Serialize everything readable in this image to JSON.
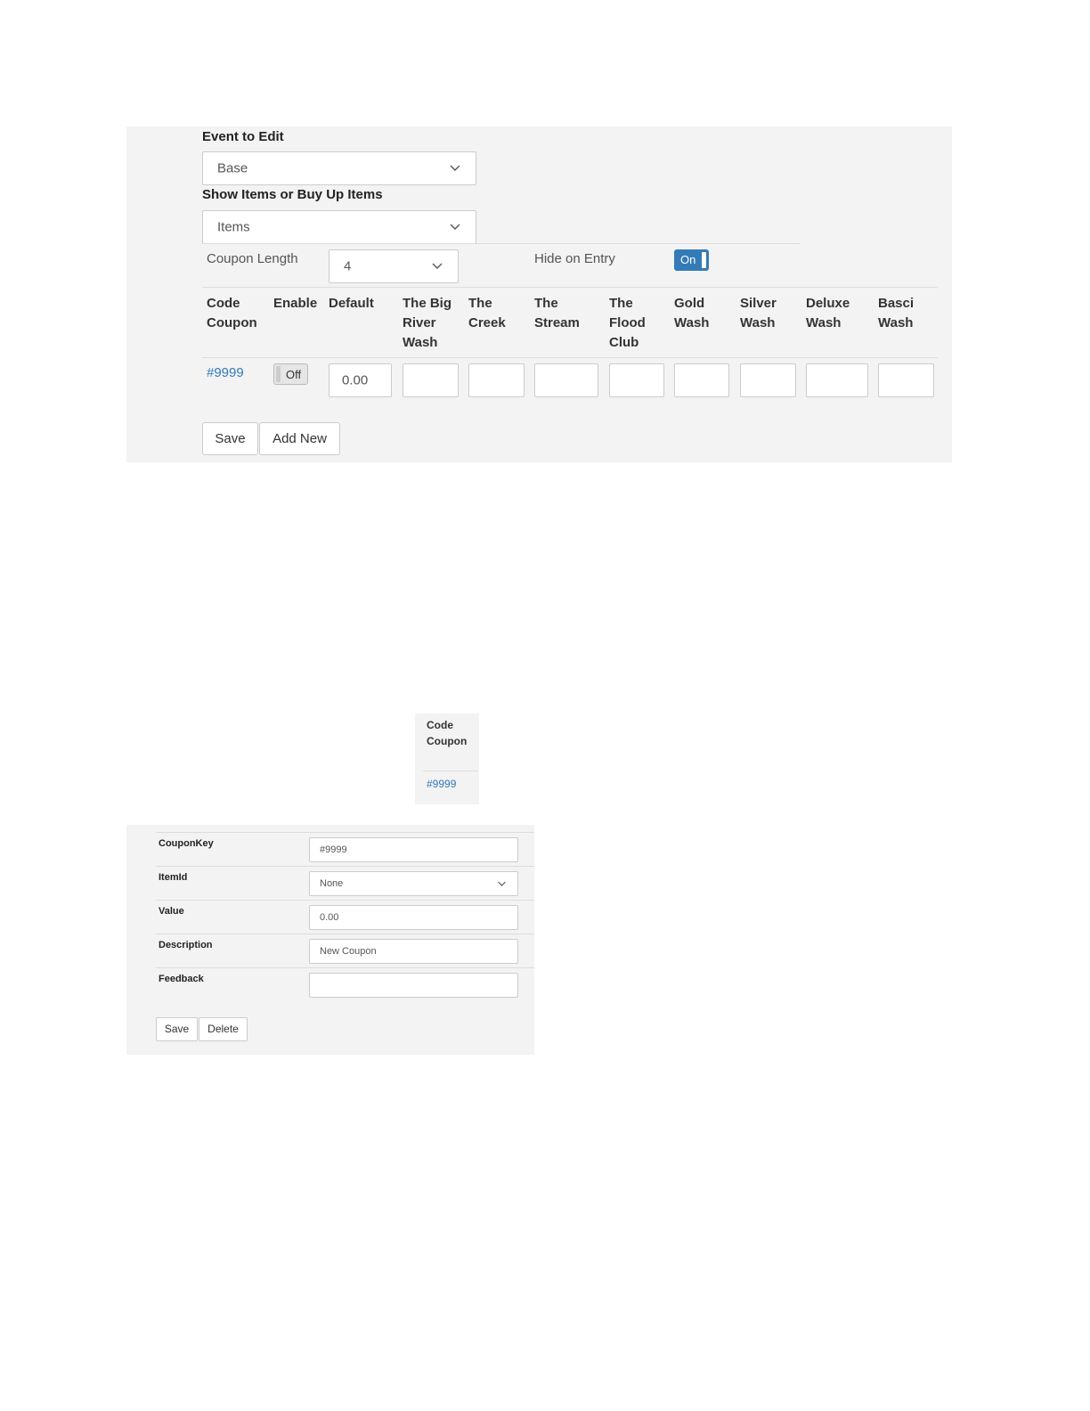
{
  "top_panel": {
    "event_label": "Event to Edit",
    "event_value": "Base",
    "show_items_label": "Show Items or Buy Up Items",
    "show_items_value": "Items",
    "coupon_length_label": "Coupon Length",
    "coupon_length_value": "4",
    "hide_on_entry_label": "Hide on Entry",
    "hide_on_entry_toggle": "On",
    "columns": [
      [
        "Code",
        "Coupon"
      ],
      [
        "Enable"
      ],
      [
        "Default"
      ],
      [
        "The Big",
        "River",
        "Wash"
      ],
      [
        "The",
        "Creek"
      ],
      [
        "The",
        "Stream"
      ],
      [
        "The",
        "Flood",
        "Club"
      ],
      [
        "Gold",
        "Wash"
      ],
      [
        "Silver",
        "Wash"
      ],
      [
        "Deluxe",
        "Wash"
      ],
      [
        "Basci",
        "Wash"
      ]
    ],
    "row": {
      "code": "#9999",
      "enable_toggle": "Off",
      "default_value": "0.00"
    },
    "save_button": "Save",
    "add_new_button": "Add New"
  },
  "mini_panel": {
    "header_line1": "Code",
    "header_line2": "Coupon",
    "code": "#9999"
  },
  "detail_panel": {
    "fields": [
      {
        "label": "CouponKey",
        "value": "#9999"
      },
      {
        "label": "ItemId",
        "value": "None"
      },
      {
        "label": "Value",
        "value": "0.00"
      },
      {
        "label": "Description",
        "value": "New Coupon"
      },
      {
        "label": "Feedback",
        "value": ""
      }
    ],
    "save_button": "Save",
    "delete_button": "Delete"
  },
  "colors": {
    "panel_bg": "#f3f3f3",
    "accent": "#337ab7",
    "border": "#cccccc"
  }
}
